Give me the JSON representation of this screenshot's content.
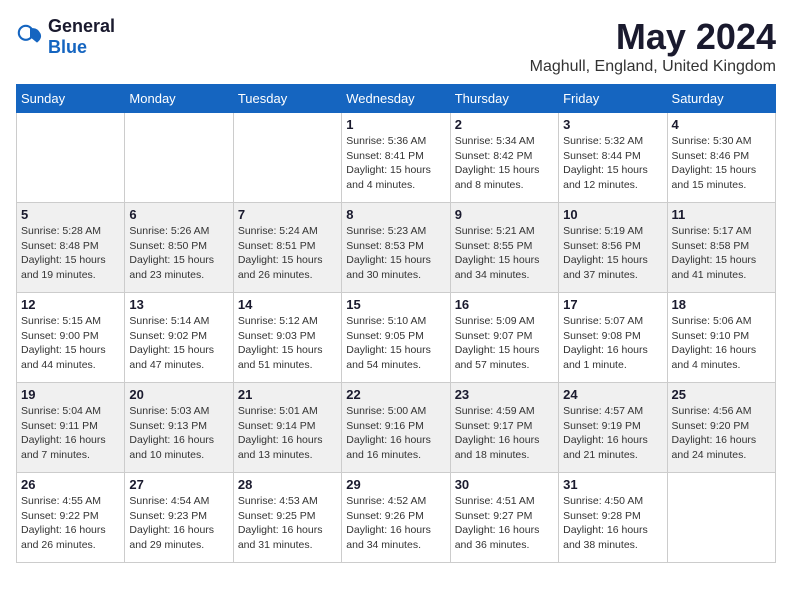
{
  "header": {
    "logo_general": "General",
    "logo_blue": "Blue",
    "month_year": "May 2024",
    "location": "Maghull, England, United Kingdom"
  },
  "days_of_week": [
    "Sunday",
    "Monday",
    "Tuesday",
    "Wednesday",
    "Thursday",
    "Friday",
    "Saturday"
  ],
  "weeks": [
    [
      {
        "day": "",
        "info": ""
      },
      {
        "day": "",
        "info": ""
      },
      {
        "day": "",
        "info": ""
      },
      {
        "day": "1",
        "info": "Sunrise: 5:36 AM\nSunset: 8:41 PM\nDaylight: 15 hours\nand 4 minutes."
      },
      {
        "day": "2",
        "info": "Sunrise: 5:34 AM\nSunset: 8:42 PM\nDaylight: 15 hours\nand 8 minutes."
      },
      {
        "day": "3",
        "info": "Sunrise: 5:32 AM\nSunset: 8:44 PM\nDaylight: 15 hours\nand 12 minutes."
      },
      {
        "day": "4",
        "info": "Sunrise: 5:30 AM\nSunset: 8:46 PM\nDaylight: 15 hours\nand 15 minutes."
      }
    ],
    [
      {
        "day": "5",
        "info": "Sunrise: 5:28 AM\nSunset: 8:48 PM\nDaylight: 15 hours\nand 19 minutes."
      },
      {
        "day": "6",
        "info": "Sunrise: 5:26 AM\nSunset: 8:50 PM\nDaylight: 15 hours\nand 23 minutes."
      },
      {
        "day": "7",
        "info": "Sunrise: 5:24 AM\nSunset: 8:51 PM\nDaylight: 15 hours\nand 26 minutes."
      },
      {
        "day": "8",
        "info": "Sunrise: 5:23 AM\nSunset: 8:53 PM\nDaylight: 15 hours\nand 30 minutes."
      },
      {
        "day": "9",
        "info": "Sunrise: 5:21 AM\nSunset: 8:55 PM\nDaylight: 15 hours\nand 34 minutes."
      },
      {
        "day": "10",
        "info": "Sunrise: 5:19 AM\nSunset: 8:56 PM\nDaylight: 15 hours\nand 37 minutes."
      },
      {
        "day": "11",
        "info": "Sunrise: 5:17 AM\nSunset: 8:58 PM\nDaylight: 15 hours\nand 41 minutes."
      }
    ],
    [
      {
        "day": "12",
        "info": "Sunrise: 5:15 AM\nSunset: 9:00 PM\nDaylight: 15 hours\nand 44 minutes."
      },
      {
        "day": "13",
        "info": "Sunrise: 5:14 AM\nSunset: 9:02 PM\nDaylight: 15 hours\nand 47 minutes."
      },
      {
        "day": "14",
        "info": "Sunrise: 5:12 AM\nSunset: 9:03 PM\nDaylight: 15 hours\nand 51 minutes."
      },
      {
        "day": "15",
        "info": "Sunrise: 5:10 AM\nSunset: 9:05 PM\nDaylight: 15 hours\nand 54 minutes."
      },
      {
        "day": "16",
        "info": "Sunrise: 5:09 AM\nSunset: 9:07 PM\nDaylight: 15 hours\nand 57 minutes."
      },
      {
        "day": "17",
        "info": "Sunrise: 5:07 AM\nSunset: 9:08 PM\nDaylight: 16 hours\nand 1 minute."
      },
      {
        "day": "18",
        "info": "Sunrise: 5:06 AM\nSunset: 9:10 PM\nDaylight: 16 hours\nand 4 minutes."
      }
    ],
    [
      {
        "day": "19",
        "info": "Sunrise: 5:04 AM\nSunset: 9:11 PM\nDaylight: 16 hours\nand 7 minutes."
      },
      {
        "day": "20",
        "info": "Sunrise: 5:03 AM\nSunset: 9:13 PM\nDaylight: 16 hours\nand 10 minutes."
      },
      {
        "day": "21",
        "info": "Sunrise: 5:01 AM\nSunset: 9:14 PM\nDaylight: 16 hours\nand 13 minutes."
      },
      {
        "day": "22",
        "info": "Sunrise: 5:00 AM\nSunset: 9:16 PM\nDaylight: 16 hours\nand 16 minutes."
      },
      {
        "day": "23",
        "info": "Sunrise: 4:59 AM\nSunset: 9:17 PM\nDaylight: 16 hours\nand 18 minutes."
      },
      {
        "day": "24",
        "info": "Sunrise: 4:57 AM\nSunset: 9:19 PM\nDaylight: 16 hours\nand 21 minutes."
      },
      {
        "day": "25",
        "info": "Sunrise: 4:56 AM\nSunset: 9:20 PM\nDaylight: 16 hours\nand 24 minutes."
      }
    ],
    [
      {
        "day": "26",
        "info": "Sunrise: 4:55 AM\nSunset: 9:22 PM\nDaylight: 16 hours\nand 26 minutes."
      },
      {
        "day": "27",
        "info": "Sunrise: 4:54 AM\nSunset: 9:23 PM\nDaylight: 16 hours\nand 29 minutes."
      },
      {
        "day": "28",
        "info": "Sunrise: 4:53 AM\nSunset: 9:25 PM\nDaylight: 16 hours\nand 31 minutes."
      },
      {
        "day": "29",
        "info": "Sunrise: 4:52 AM\nSunset: 9:26 PM\nDaylight: 16 hours\nand 34 minutes."
      },
      {
        "day": "30",
        "info": "Sunrise: 4:51 AM\nSunset: 9:27 PM\nDaylight: 16 hours\nand 36 minutes."
      },
      {
        "day": "31",
        "info": "Sunrise: 4:50 AM\nSunset: 9:28 PM\nDaylight: 16 hours\nand 38 minutes."
      },
      {
        "day": "",
        "info": ""
      }
    ]
  ]
}
